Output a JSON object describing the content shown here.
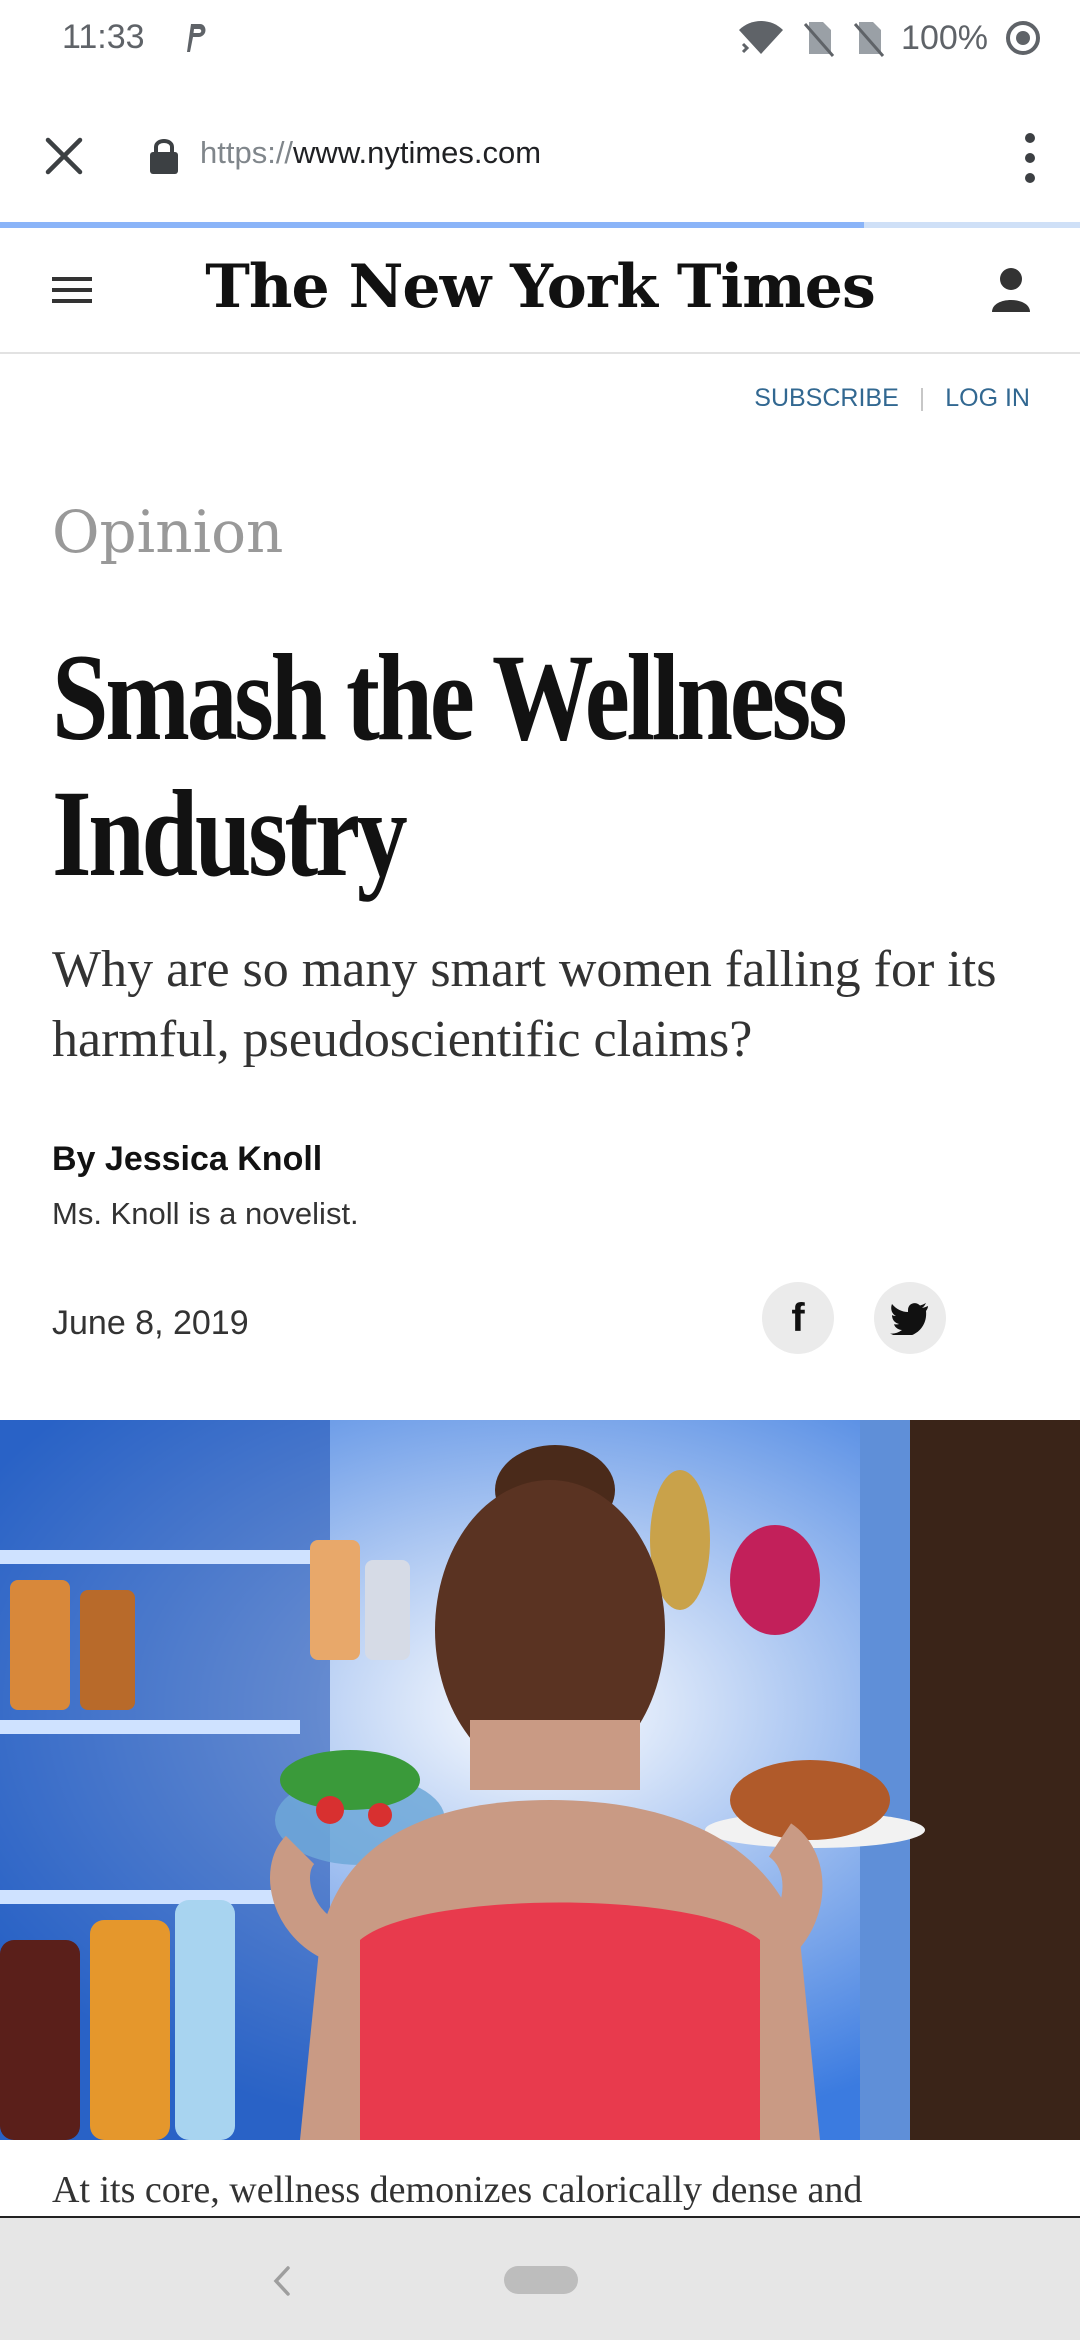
{
  "status_bar": {
    "time": "11:33",
    "battery": "100%"
  },
  "browser": {
    "url_scheme": "https://",
    "url_host": "www.nytimes.com",
    "load_progress": 0.8
  },
  "masthead": {
    "logo": "The New York Times"
  },
  "auth": {
    "subscribe": "SUBSCRIBE",
    "separator": "|",
    "login": "LOG IN"
  },
  "article": {
    "section": "Opinion",
    "headline": "Smash the Wellness Industry",
    "summary": "Why are so many smart women falling for its harmful, pseudoscientific claims?",
    "byline": "By Jessica Knoll",
    "byline_desc": "Ms. Knoll is a novelist.",
    "date": "June 8, 2019",
    "body_first_line": "At its core, wellness demonizes calorically dense and"
  },
  "share": {
    "facebook_glyph": "f"
  },
  "colors": {
    "link_blue": "#326891",
    "progress": "#8ab4f8"
  }
}
